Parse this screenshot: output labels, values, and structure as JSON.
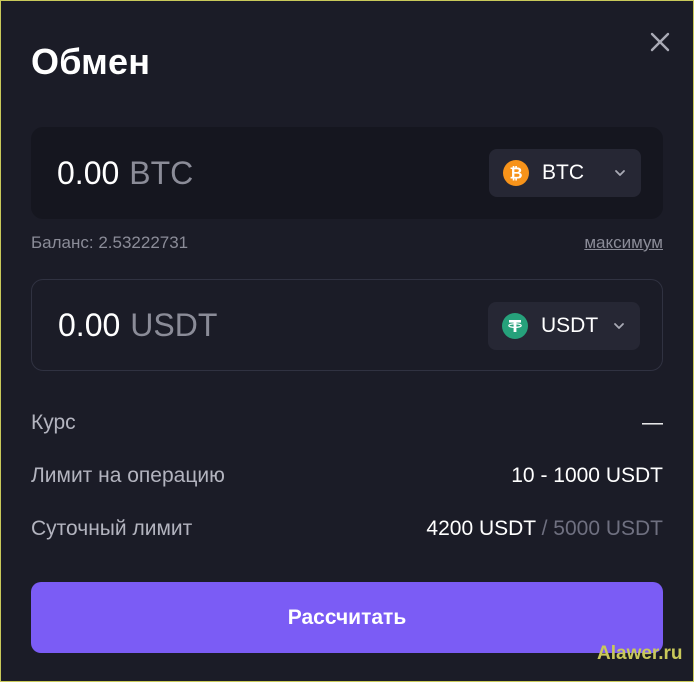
{
  "header": {
    "title": "Обмен"
  },
  "from": {
    "amount": "0.00",
    "unit": "BTC",
    "currency": "BTC",
    "icon": "bitcoin-icon",
    "color": "#f7931a"
  },
  "balance": {
    "text": "Баланс: 2.53222731",
    "max_label": "максимум"
  },
  "to": {
    "amount": "0.00",
    "unit": "USDT",
    "currency": "USDT",
    "icon": "tether-icon",
    "color": "#26a17b"
  },
  "info": {
    "rate_label": "Курс",
    "rate_value": "—",
    "limit_label": "Лимит на операцию",
    "limit_value": "10 - 1000 USDT",
    "daily_label": "Суточный лимит",
    "daily_used": "4200 USDT",
    "daily_sep": " / ",
    "daily_total": "5000 USDT"
  },
  "submit_label": "Рассчитать",
  "watermark": "Alawer.ru",
  "colors": {
    "accent": "#7b5cf5",
    "background": "#1b1c27"
  }
}
